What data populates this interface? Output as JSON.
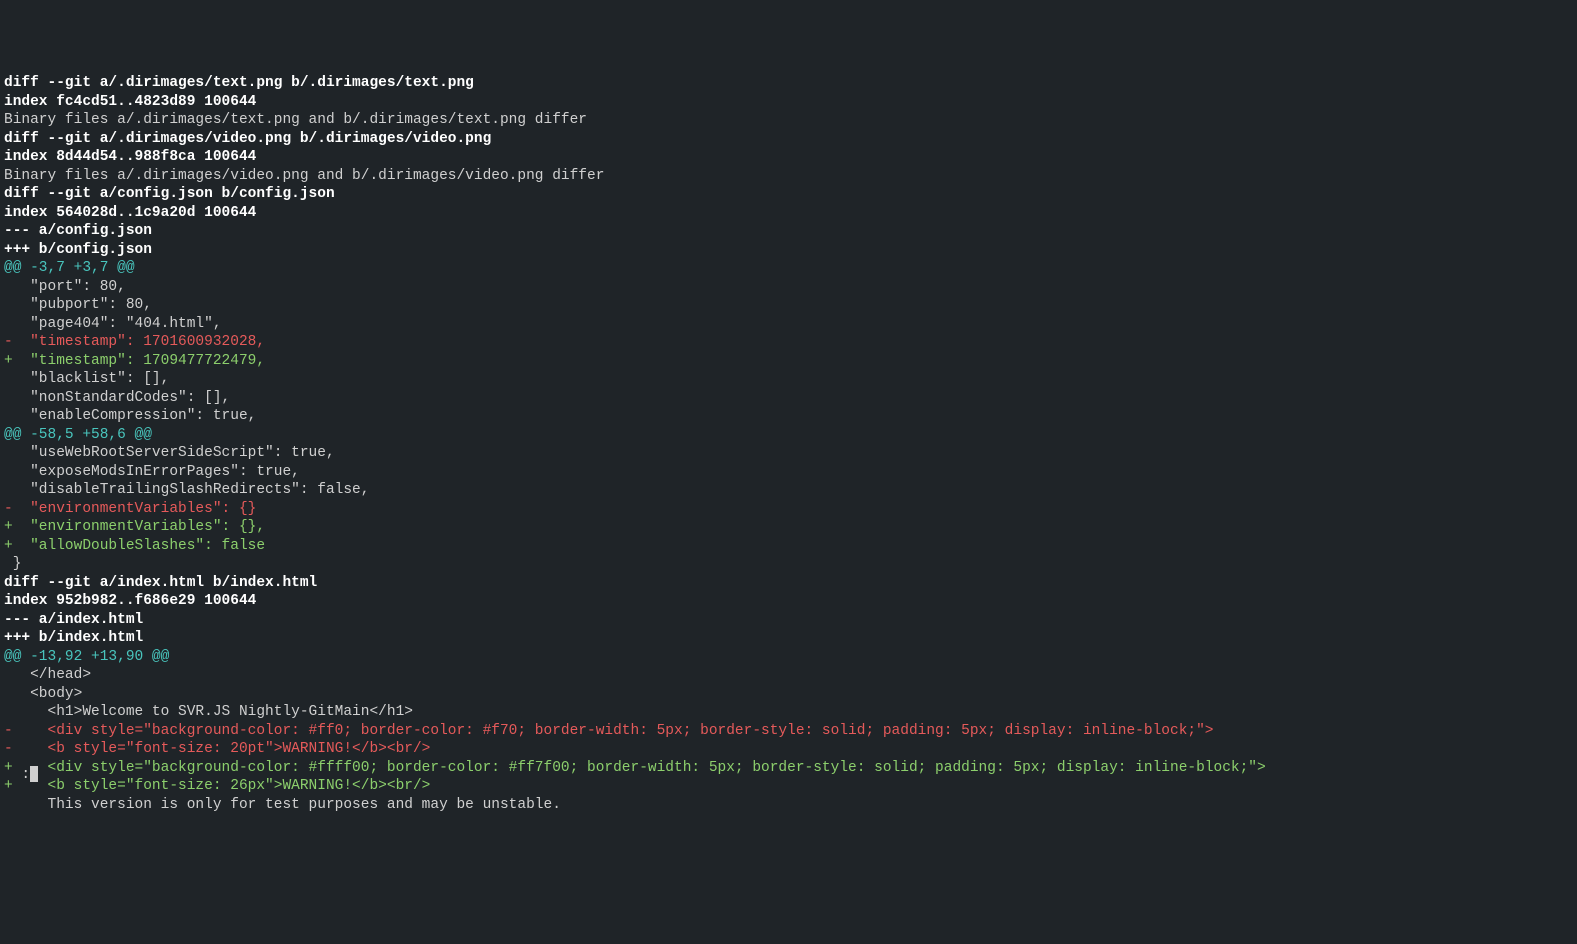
{
  "lines": [
    {
      "class": "bold",
      "text": "diff --git a/.dirimages/text.png b/.dirimages/text.png"
    },
    {
      "class": "bold",
      "text": "index fc4cd51..4823d89 100644"
    },
    {
      "class": "normal",
      "text": "Binary files a/.dirimages/text.png and b/.dirimages/text.png differ"
    },
    {
      "class": "bold",
      "text": "diff --git a/.dirimages/video.png b/.dirimages/video.png"
    },
    {
      "class": "bold",
      "text": "index 8d44d54..988f8ca 100644"
    },
    {
      "class": "normal",
      "text": "Binary files a/.dirimages/video.png and b/.dirimages/video.png differ"
    },
    {
      "class": "bold",
      "text": "diff --git a/config.json b/config.json"
    },
    {
      "class": "bold",
      "text": "index 564028d..1c9a20d 100644"
    },
    {
      "class": "bold",
      "text": "--- a/config.json"
    },
    {
      "class": "bold",
      "text": "+++ b/config.json"
    },
    {
      "class": "cyan",
      "text": "@@ -3,7 +3,7 @@"
    },
    {
      "class": "normal",
      "text": "   \"port\": 80,"
    },
    {
      "class": "normal",
      "text": "   \"pubport\": 80,"
    },
    {
      "class": "normal",
      "text": "   \"page404\": \"404.html\","
    },
    {
      "class": "red",
      "text": "-  \"timestamp\": 1701600932028,"
    },
    {
      "class": "green",
      "text": "+  \"timestamp\": 1709477722479,"
    },
    {
      "class": "normal",
      "text": "   \"blacklist\": [],"
    },
    {
      "class": "normal",
      "text": "   \"nonStandardCodes\": [],"
    },
    {
      "class": "normal",
      "text": "   \"enableCompression\": true,"
    },
    {
      "class": "cyan",
      "text": "@@ -58,5 +58,6 @@"
    },
    {
      "class": "normal",
      "text": "   \"useWebRootServerSideScript\": true,"
    },
    {
      "class": "normal",
      "text": "   \"exposeModsInErrorPages\": true,"
    },
    {
      "class": "normal",
      "text": "   \"disableTrailingSlashRedirects\": false,"
    },
    {
      "class": "red",
      "text": "-  \"environmentVariables\": {}"
    },
    {
      "class": "green",
      "text": "+  \"environmentVariables\": {},"
    },
    {
      "class": "green",
      "text": "+  \"allowDoubleSlashes\": false"
    },
    {
      "class": "normal",
      "text": " }"
    },
    {
      "class": "bold",
      "text": "diff --git a/index.html b/index.html"
    },
    {
      "class": "bold",
      "text": "index 952b982..f686e29 100644"
    },
    {
      "class": "bold",
      "text": "--- a/index.html"
    },
    {
      "class": "bold",
      "text": "+++ b/index.html"
    },
    {
      "class": "cyan",
      "text": "@@ -13,92 +13,90 @@"
    },
    {
      "class": "normal",
      "text": "   </head>"
    },
    {
      "class": "normal",
      "text": "   <body>"
    },
    {
      "class": "normal",
      "text": "     <h1>Welcome to SVR.JS Nightly-GitMain</h1>"
    },
    {
      "class": "red",
      "text": "-    <div style=\"background-color: #ff0; border-color: #f70; border-width: 5px; border-style: solid; padding: 5px; display: inline-block;\">"
    },
    {
      "class": "red",
      "text": "-    <b style=\"font-size: 20pt\">WARNING!</b><br/>"
    },
    {
      "class": "green",
      "text": "+    <div style=\"background-color: #ffff00; border-color: #ff7f00; border-width: 5px; border-style: solid; padding: 5px; display: inline-block;\">"
    },
    {
      "class": "green",
      "text": "+    <b style=\"font-size: 26px\">WARNING!</b><br/>"
    },
    {
      "class": "normal",
      "text": "     This version is only for test purposes and may be unstable."
    }
  ],
  "prompt": ":"
}
